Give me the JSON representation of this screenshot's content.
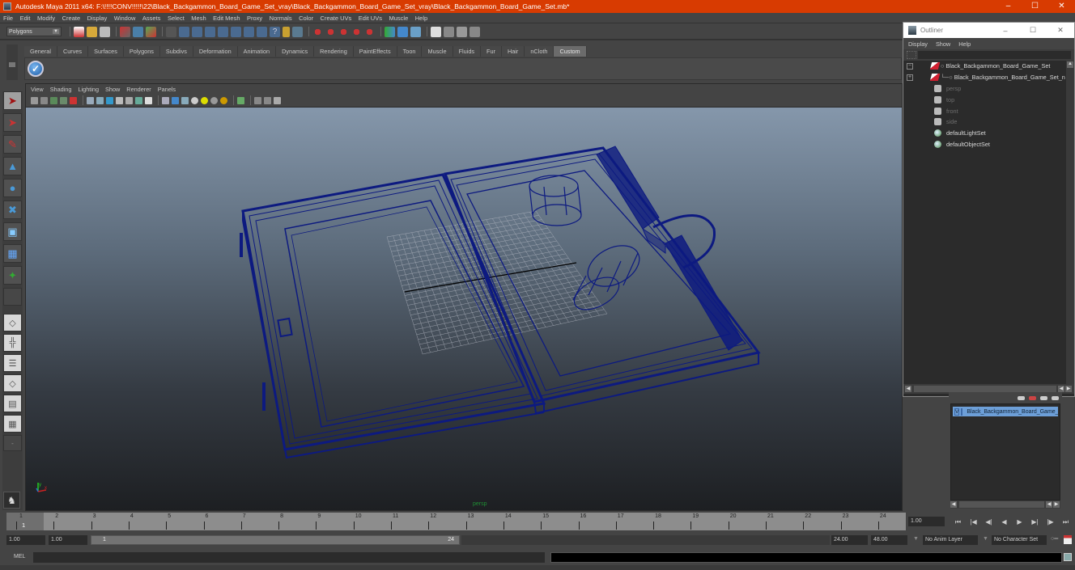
{
  "window": {
    "title": "Autodesk Maya 2011 x64: F:\\!!!!CONV!!!!!\\22\\Black_Backgammon_Board_Game_Set_vray\\Black_Backgammon_Board_Game_Set_vray\\Black_Backgammon_Board_Game_Set.mb*",
    "controls": {
      "minimize": "–",
      "maximize": "☐",
      "close": "✕"
    }
  },
  "menubar": [
    "File",
    "Edit",
    "Modify",
    "Create",
    "Display",
    "Window",
    "Assets",
    "Select",
    "Mesh",
    "Edit Mesh",
    "Proxy",
    "Normals",
    "Color",
    "Create UVs",
    "Edit UVs",
    "Muscle",
    "Help"
  ],
  "statusline": {
    "mode": "Polygons",
    "icons": [
      "new-scene",
      "open-scene",
      "save-scene",
      "select-by-hierarchy",
      "select-by-object",
      "select-by-component",
      "lock-selection",
      "snap-grid",
      "snap-curve",
      "snap-point",
      "snap-view-plane",
      "make-live",
      "history",
      "render-current",
      "ipr-render",
      "render-settings",
      "hypershade",
      "construction-history",
      "input-ops",
      "output-ops",
      "show-attributes",
      "show-tool-settings",
      "show-channel-box",
      "render-view",
      "render-frame",
      "render-region",
      "render-settings-2"
    ]
  },
  "shelf": {
    "tabs": [
      "General",
      "Curves",
      "Surfaces",
      "Polygons",
      "Subdivs",
      "Deformation",
      "Animation",
      "Dynamics",
      "Rendering",
      "PaintEffects",
      "Toon",
      "Muscle",
      "Fluids",
      "Fur",
      "Hair",
      "nCloth",
      "Custom"
    ],
    "active_tab": "Custom",
    "items": [
      "checkmark-script-icon"
    ]
  },
  "toolbox": {
    "tools": [
      "select-tool",
      "lasso-tool",
      "paint-select-tool",
      "move-tool",
      "rotate-tool",
      "scale-tool",
      "universal-manipulator",
      "soft-mod-tool",
      "show-manipulator",
      "last-tool"
    ],
    "layouts": [
      "single-perspective-layout",
      "four-view-layout",
      "persp-outliner-layout",
      "persp-graph-layout",
      "hypershade-persp-layout",
      "persp-graph-hypergraph-layout"
    ]
  },
  "panel": {
    "menu": [
      "View",
      "Shading",
      "Lighting",
      "Show",
      "Renderer",
      "Panels"
    ],
    "camera_label": "persp",
    "axis": {
      "x": "x",
      "y": "y"
    }
  },
  "outliner": {
    "title": "Outliner",
    "menu": [
      "Display",
      "Show",
      "Help"
    ],
    "filter_value": "",
    "items": [
      {
        "label": "Black_Backgammon_Board_Game_Set",
        "type": "mesh",
        "expander": "−",
        "dim": false
      },
      {
        "label": "Black_Backgammon_Board_Game_Set_n",
        "type": "mesh-child",
        "expander": "+",
        "dim": false
      },
      {
        "label": "persp",
        "type": "camera",
        "dim": true
      },
      {
        "label": "top",
        "type": "camera",
        "dim": true
      },
      {
        "label": "front",
        "type": "camera",
        "dim": true
      },
      {
        "label": "side",
        "type": "camera",
        "dim": true
      },
      {
        "label": "defaultLightSet",
        "type": "set",
        "dim": false
      },
      {
        "label": "defaultObjectSet",
        "type": "set",
        "dim": false
      }
    ]
  },
  "layers": {
    "rows": [
      {
        "visible": "V",
        "playback": "",
        "name": "Black_Backgammon_Board_Game_Set"
      }
    ]
  },
  "timeline": {
    "ticks": [
      "1",
      "2",
      "3",
      "4",
      "5",
      "6",
      "7",
      "8",
      "9",
      "10",
      "11",
      "12",
      "13",
      "14",
      "15",
      "16",
      "17",
      "18",
      "19",
      "20",
      "21",
      "22",
      "23",
      "24"
    ],
    "current_frame": "1",
    "current_time": "1.00",
    "playback_buttons": [
      "⏮",
      "|◀",
      "◀|",
      "◀",
      "▶",
      "▶|",
      "|▶",
      "⏭"
    ]
  },
  "range": {
    "start_time": "1.00",
    "playback_start": "1.00",
    "slider_start": "1",
    "slider_end": "24",
    "playback_end": "24.00",
    "end_time": "48.00",
    "anim_layer": "No Anim Layer",
    "character_set": "No Character Set"
  },
  "command": {
    "label": "MEL",
    "input": "",
    "output": ""
  },
  "colors": {
    "titlebar": "#d83b01",
    "wireframe": "#0d1a80",
    "layer_highlight": "#6d9fd8"
  }
}
